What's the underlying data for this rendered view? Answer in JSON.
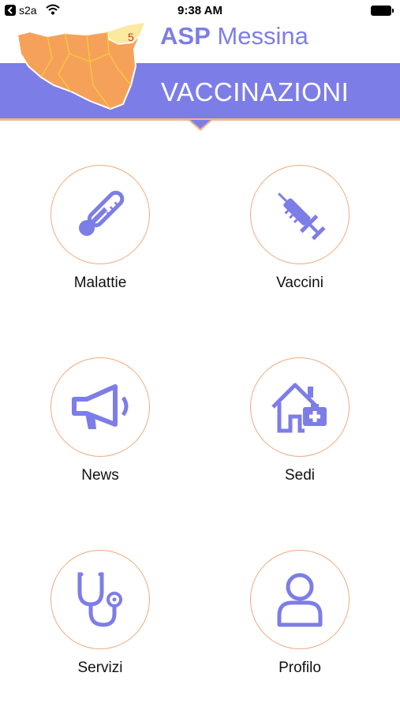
{
  "status_bar": {
    "back_app": "s2a",
    "time": "9:38 AM"
  },
  "header": {
    "brand_bold": "ASP",
    "brand_rest": "Messina",
    "section_title": "VACCINAZIONI",
    "map_badge": "5"
  },
  "colors": {
    "accent": "#7d7de8",
    "circle_border": "#f3a97e",
    "map_fill": "#f6a15a",
    "map_highlight": "#fbe9a0"
  },
  "menu": [
    {
      "label": "Malattie",
      "icon": "thermometer-icon"
    },
    {
      "label": "Vaccini",
      "icon": "syringe-icon"
    },
    {
      "label": "News",
      "icon": "megaphone-icon"
    },
    {
      "label": "Sedi",
      "icon": "clinic-house-icon"
    },
    {
      "label": "Servizi",
      "icon": "stethoscope-icon"
    },
    {
      "label": "Profilo",
      "icon": "user-icon"
    }
  ]
}
